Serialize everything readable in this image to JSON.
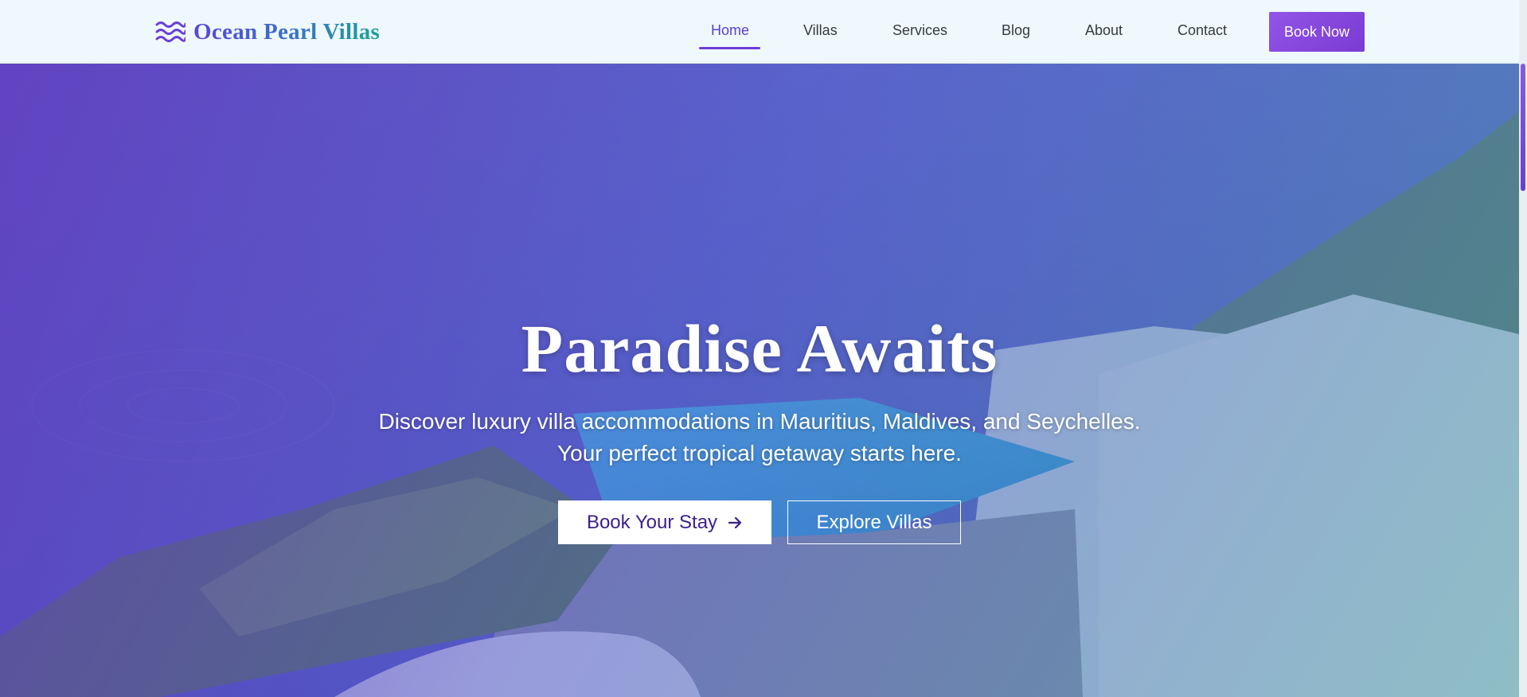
{
  "brand": {
    "name": "Ocean Pearl Villas",
    "icon": "waves-icon"
  },
  "nav": {
    "items": [
      {
        "label": "Home",
        "active": true
      },
      {
        "label": "Villas",
        "active": false
      },
      {
        "label": "Services",
        "active": false
      },
      {
        "label": "Blog",
        "active": false
      },
      {
        "label": "About",
        "active": false
      },
      {
        "label": "Contact",
        "active": false
      }
    ],
    "cta_label": "Book Now"
  },
  "hero": {
    "title": "Paradise Awaits",
    "subtitle_line1": "Discover luxury villa accommodations in Mauritius, Maldives, and Seychelles.",
    "subtitle_line2": "Your perfect tropical getaway starts here.",
    "primary_button": "Book Your Stay",
    "primary_button_icon": "arrow-right-icon",
    "secondary_button": "Explore Villas"
  },
  "colors": {
    "accent": "#7a3bd3",
    "nav_active": "#5b3fd6",
    "navbar_bg": "#eff8fc"
  }
}
